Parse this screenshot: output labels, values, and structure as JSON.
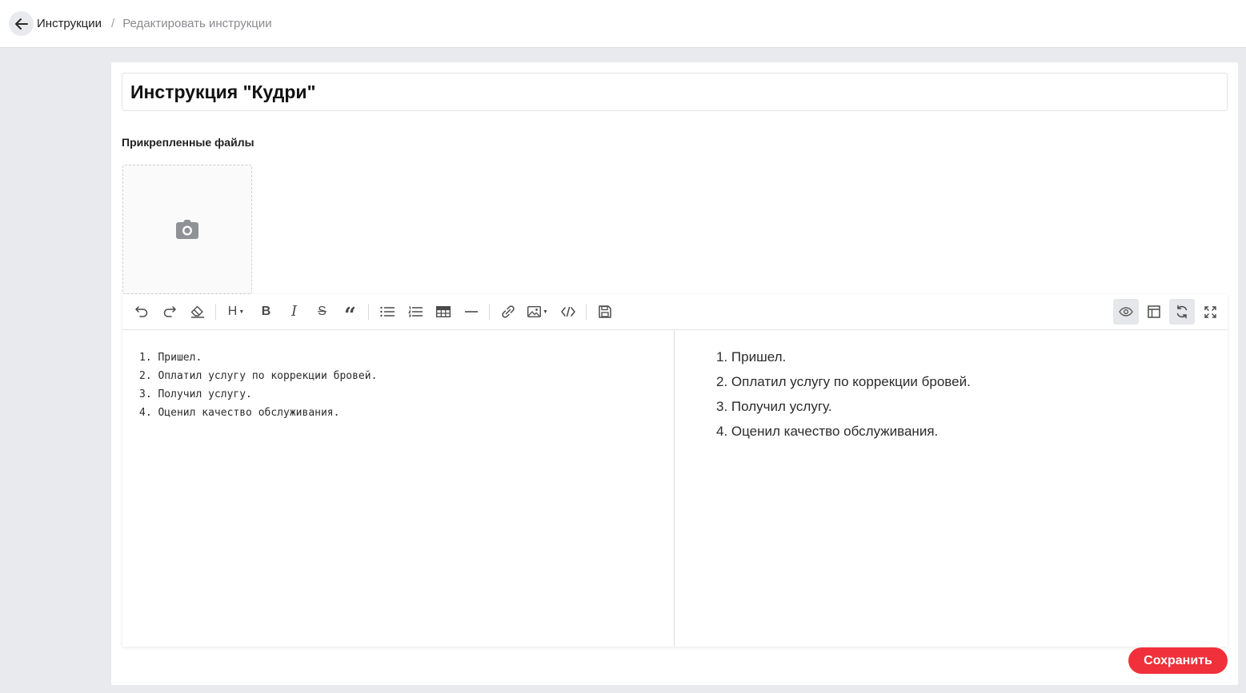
{
  "breadcrumb": {
    "parent": "Инструкции",
    "separator": "/",
    "current": "Редактировать инструкции"
  },
  "title_field": {
    "value": "Инструкция \"Кудри\""
  },
  "attachments": {
    "label": "Прикрепленные файлы",
    "upload_icon": "camera-icon"
  },
  "editor": {
    "toolbar_left": [
      "undo-icon",
      "redo-icon",
      "eraser-icon",
      "heading-icon",
      "bold-icon",
      "italic-icon",
      "strikethrough-icon",
      "quote-icon",
      "bulleted-list-icon",
      "numbered-list-icon",
      "table-icon",
      "horizontal-rule-icon",
      "link-icon",
      "image-icon",
      "code-icon",
      "save-icon"
    ],
    "toolbar_right": [
      "preview-eye-icon",
      "layout-icon",
      "sync-scroll-icon",
      "fullscreen-icon"
    ],
    "heading_label": "H",
    "bold_label": "B",
    "italic_label": "I",
    "strike_label": "S",
    "quote_label": "“",
    "source_lines": [
      "1. Пришел.",
      "2. Оплатил услугу по коррекции бровей.",
      "3. Получил услугу.",
      "4. Оценил качество обслуживания."
    ],
    "preview_lines": [
      "1. Пришел.",
      "2. Оплатил услугу по коррекции бровей.",
      "3. Получил услугу.",
      "4. Оценил качество обслуживания."
    ]
  },
  "actions": {
    "save_label": "Сохранить"
  },
  "colors": {
    "accent": "#f0303a",
    "background": "#e9eaee"
  }
}
